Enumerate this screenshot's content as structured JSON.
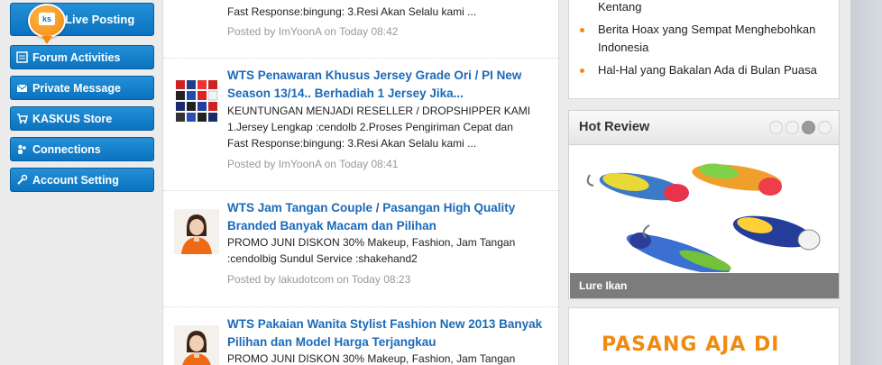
{
  "sidebar": {
    "live": "Live Posting",
    "items": [
      {
        "label": "Forum Activities",
        "icon": "forum-icon"
      },
      {
        "label": "Private Message",
        "icon": "mail-icon"
      },
      {
        "label": "KASKUS Store",
        "icon": "cart-icon"
      },
      {
        "label": "Connections",
        "icon": "people-icon"
      },
      {
        "label": "Account Setting",
        "icon": "wrench-icon"
      }
    ],
    "accent": "#0b72bf",
    "badge_color": "#f08a10"
  },
  "threads": [
    {
      "title_lines": [],
      "desc_lines": [
        "Fast Response:bingung: 3.Resi Akan Selalu kami ..."
      ],
      "meta": "Posted by ImYoonA on Today 08:42"
    },
    {
      "title_lines": [
        "WTS Penawaran Khusus Jersey Grade Ori / PI New",
        "Season 13/14.. Berhadiah 1 Jersey Jika..."
      ],
      "desc_lines": [
        "KEUNTUNGAN MENJADI RESELLER / DROPSHIPPER KAMI",
        "1.Jersey Lengkap :cendolb 2.Proses Pengiriman Cepat dan",
        "Fast Response:bingung: 3.Resi Akan Selalu kami ..."
      ],
      "meta": "Posted by ImYoonA on Today 08:41"
    },
    {
      "title_lines": [
        "WTS Jam Tangan Couple / Pasangan High Quality",
        "Branded Banyak Macam dan Pilihan"
      ],
      "desc_lines": [
        "PROMO JUNI DISKON 30% Makeup, Fashion, Jam Tangan",
        ":cendolbig Sundul Service :shakehand2"
      ],
      "meta": "Posted by lakudotcom on Today 08:23"
    },
    {
      "title_lines": [
        "WTS Pakaian Wanita Stylist Fashion New 2013 Banyak",
        "Pilihan dan Model Harga Terjangkau"
      ],
      "desc_lines": [
        "PROMO JUNI DISKON 30% Makeup, Fashion, Jam Tangan"
      ],
      "meta": ""
    }
  ],
  "news": [
    {
      "lines": [
        "Kentang"
      ]
    },
    {
      "lines": [
        "Berita Hoax yang Sempat Menghebohkan",
        "Indonesia"
      ]
    },
    {
      "lines": [
        "Hal-Hal yang Bakalan Ada di Bulan Puasa"
      ]
    }
  ],
  "hot_review": {
    "title": "Hot Review",
    "caption": "Lure Ikan",
    "pages": 4,
    "active_page": 3
  },
  "ad": {
    "text": "PASANG AJA DI"
  },
  "link_color": "#1b6ab8"
}
